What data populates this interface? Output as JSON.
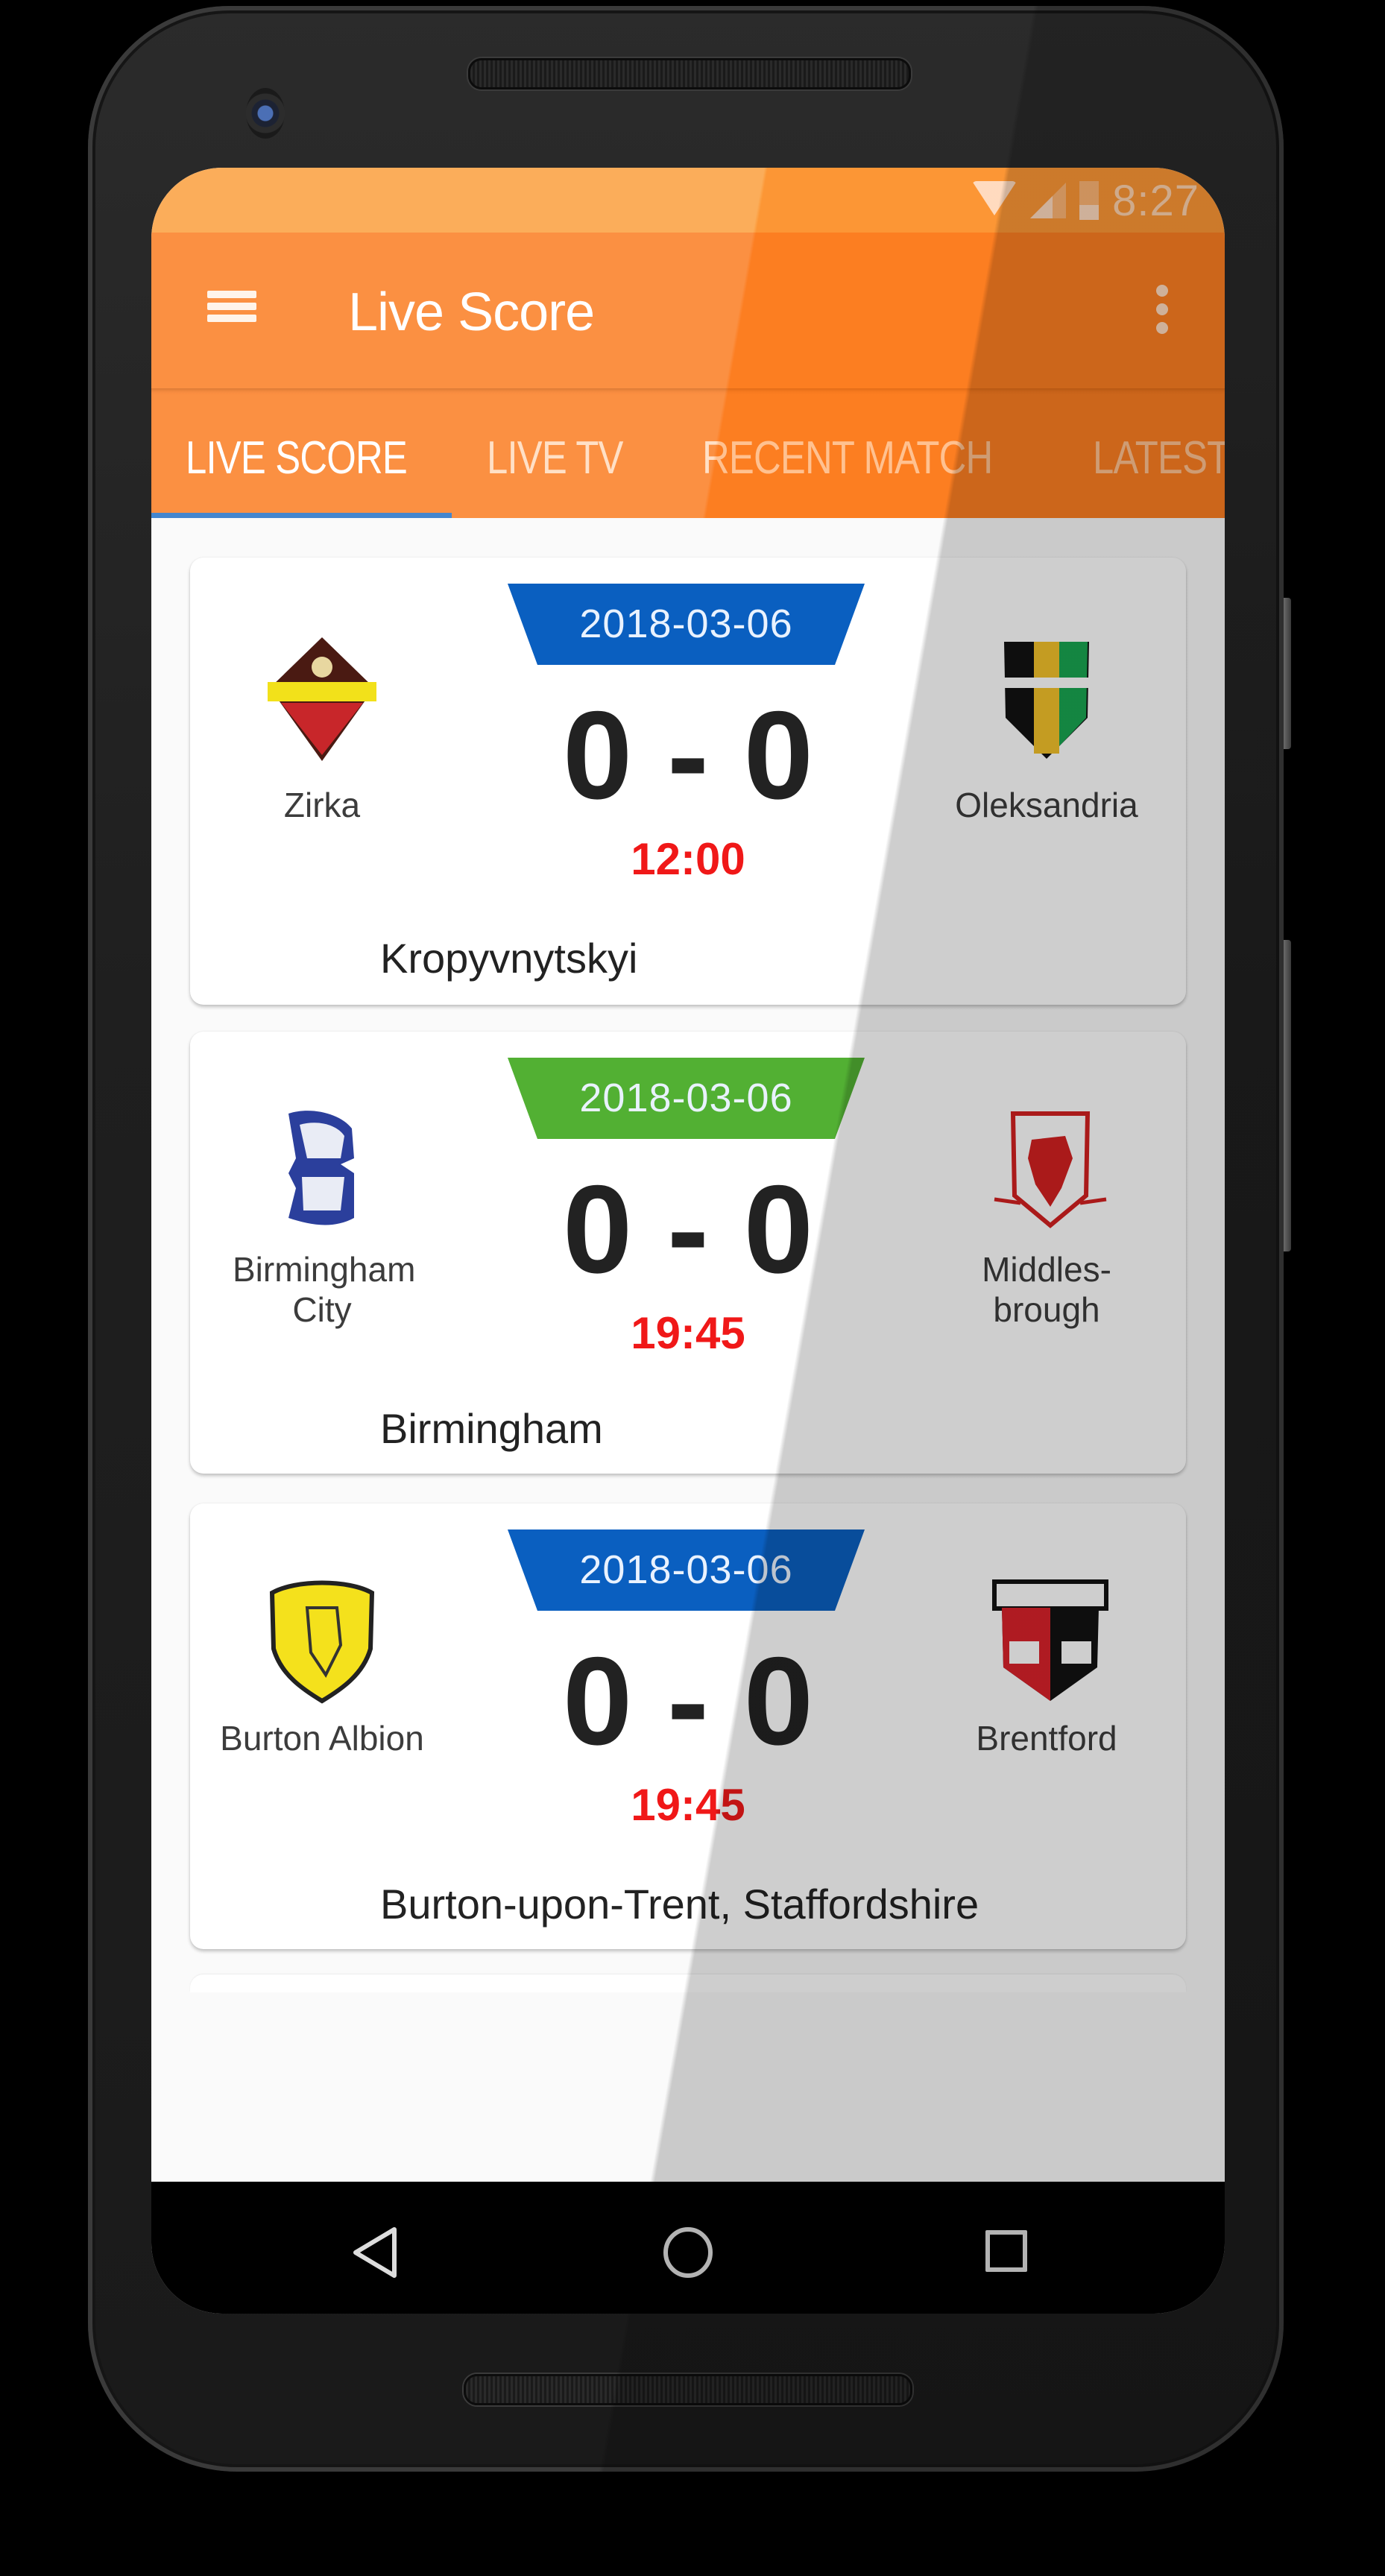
{
  "status_bar": {
    "time": "8:27",
    "icons": [
      "wifi-icon",
      "signal-icon",
      "battery-icon"
    ]
  },
  "app_bar": {
    "title": "Live Score",
    "menu_icon": "hamburger-icon",
    "overflow_icon": "more-vert-icon"
  },
  "tabs": [
    {
      "label": "LIVE SCORE",
      "active": true
    },
    {
      "label": "LIVE TV",
      "active": false
    },
    {
      "label": "RECENT MATCH",
      "active": false
    },
    {
      "label": "LATEST",
      "active": false
    }
  ],
  "colors": {
    "status_bar": "#fba447",
    "app_bar": "#fb832c",
    "tab_indicator": "#2f78c8",
    "badge_blue": "#0a5fc0",
    "badge_green": "#52b033",
    "time_red": "#f01818",
    "score_text": "#222222"
  },
  "matches": [
    {
      "date": "2018-03-06",
      "badge_color": "blue",
      "home_team": "Zirka",
      "away_team": "Oleksandria",
      "home_score": "0",
      "away_score": "0",
      "score_separator": "-",
      "score": "0 - 0",
      "time": "12:00",
      "venue": "Kropyvnytskyi"
    },
    {
      "date": "2018-03-06",
      "badge_color": "green",
      "home_team": "Birmingham City",
      "away_team": "Middles-brough",
      "home_score": "0",
      "away_score": "0",
      "score": "0 - 0",
      "time": "19:45",
      "venue": "Birmingham"
    },
    {
      "date": "2018-03-06",
      "badge_color": "blue",
      "home_team": "Burton Albion",
      "away_team": "Brentford",
      "home_score": "0",
      "away_score": "0",
      "score": "0 - 0",
      "time": "19:45",
      "venue": "Burton-upon-Trent, Staffordshire"
    }
  ],
  "nav_bar": {
    "buttons": [
      "back-icon",
      "home-icon",
      "recents-icon"
    ]
  }
}
